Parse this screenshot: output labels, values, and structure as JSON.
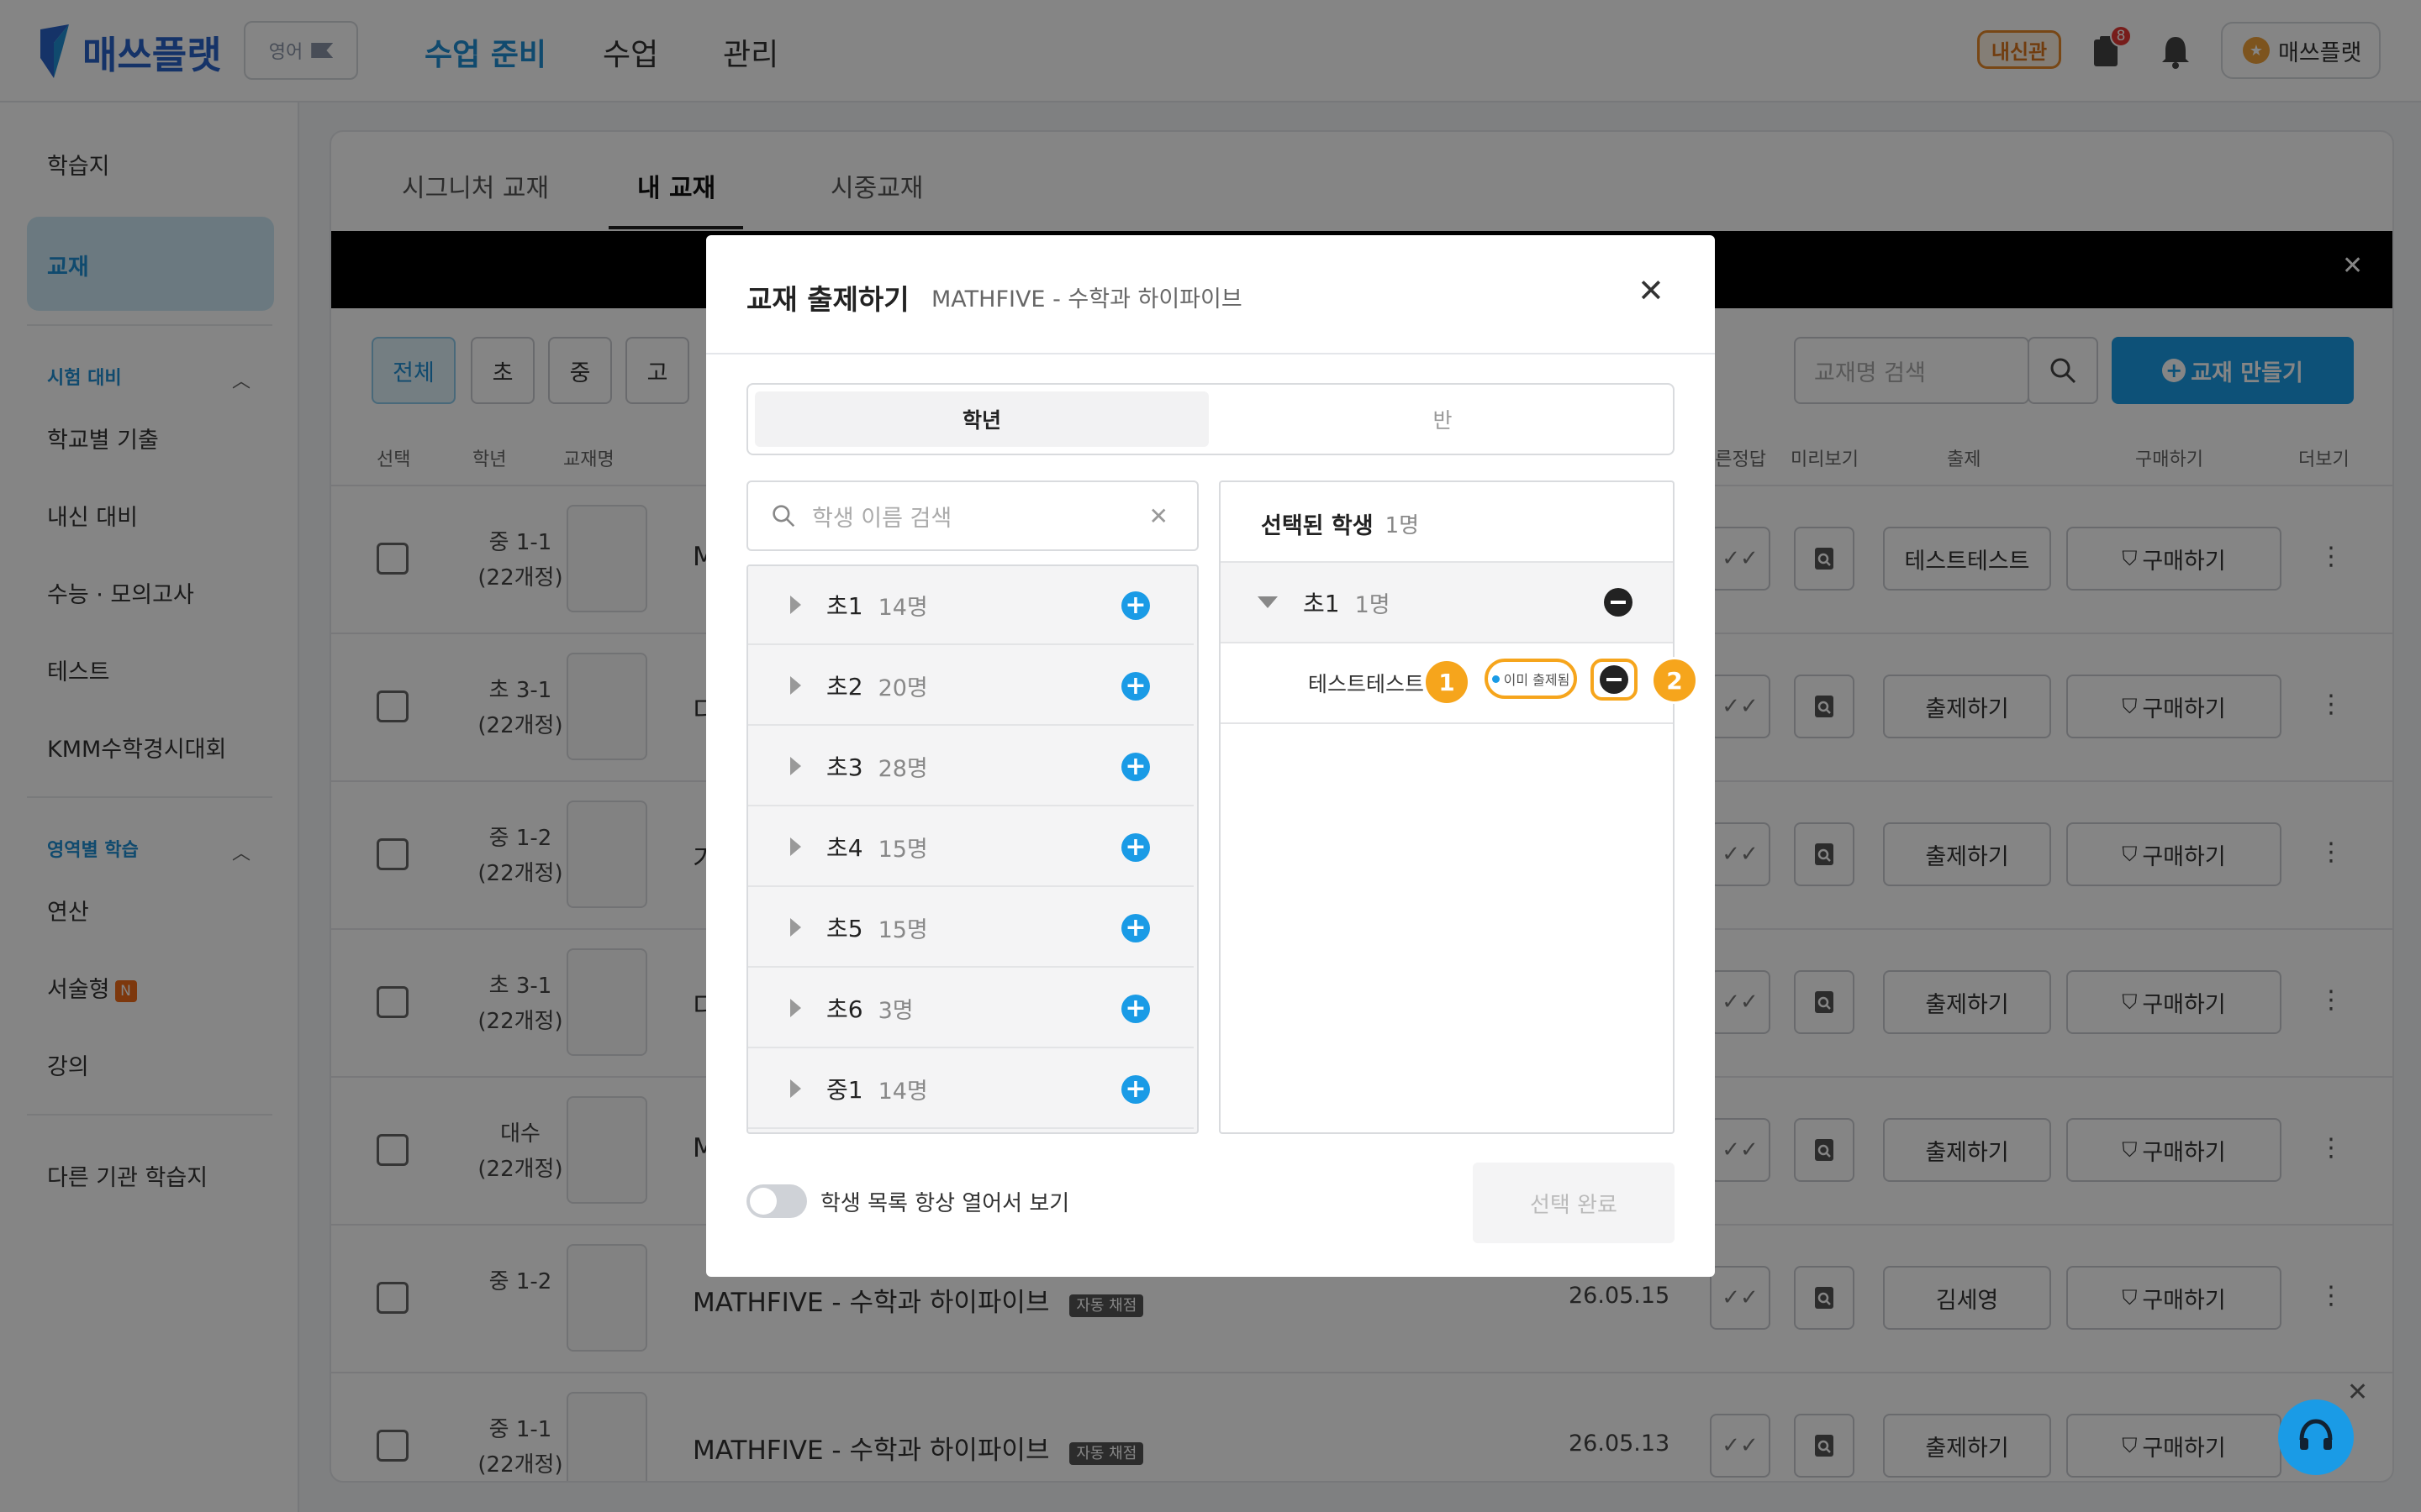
{
  "header": {
    "logo": "매쓰플랫",
    "lang_label": "영어",
    "nav": [
      "수업 준비",
      "수업",
      "관리"
    ],
    "badge_label": "내신관",
    "notif_count": "8",
    "user_name": "매쓰플랫"
  },
  "sidebar": {
    "items_top": [
      "학습지",
      "교재"
    ],
    "section1": "시험 대비",
    "section1_items": [
      "학교별 기출",
      "내신 대비",
      "수능 · 모의고사",
      "테스트",
      "KMM수학경시대회"
    ],
    "section2": "영역별 학습",
    "section2_items": [
      "연산",
      "서술형",
      "강의"
    ],
    "new_badge": "N",
    "bottom_item": "다른 기관 학습지"
  },
  "main": {
    "tabs": [
      "시그니처 교재",
      "내 교재",
      "시중교재"
    ],
    "filters": [
      "전체",
      "초",
      "중",
      "고"
    ],
    "search_placeholder": "교재명 검색",
    "create_label": "교재 만들기",
    "columns": [
      "선택",
      "학년",
      "교재명",
      "빠른정답",
      "미리보기",
      "출제",
      "구매하기",
      "더보기"
    ],
    "rows": [
      {
        "grade": "중 1-1",
        "units": "(22개정)",
        "title_initial": "M",
        "assign": "테스트테스트",
        "buy": "구매하기"
      },
      {
        "grade": "초 3-1",
        "units": "(22개정)",
        "title_initial": "디",
        "assign": "출제하기",
        "buy": "구매하기"
      },
      {
        "grade": "중 1-2",
        "units": "(22개정)",
        "title_initial": "기",
        "assign": "출제하기",
        "buy": "구매하기"
      },
      {
        "grade": "초 3-1",
        "units": "(22개정)",
        "title_initial": "디",
        "assign": "출제하기",
        "buy": "구매하기"
      },
      {
        "grade": "대수",
        "units": "(22개정)",
        "title_initial": "M",
        "assign": "출제하기",
        "buy": "구매하기"
      },
      {
        "grade": "중 1-2",
        "units": "",
        "title": "MATHFIVE - 수학과 하이파이브",
        "tag": "자동 채점",
        "date": "26.05.15",
        "assign": "김세영",
        "buy": "구매하기"
      },
      {
        "grade": "중 1-1",
        "units": "(22개정)",
        "title": "MATHFIVE - 수학과 하이파이브",
        "tag": "자동 채점",
        "date": "26.05.13",
        "assign": "출제하기",
        "buy": "구매하기"
      }
    ]
  },
  "modal": {
    "title": "교재 출제하기",
    "subtitle": "MATHFIVE - 수학과 하이파이브",
    "seg_grade": "학년",
    "seg_class": "반",
    "search_placeholder": "학생 이름 검색",
    "groups": [
      {
        "name": "초1",
        "count": "14명"
      },
      {
        "name": "초2",
        "count": "20명"
      },
      {
        "name": "초3",
        "count": "28명"
      },
      {
        "name": "초4",
        "count": "15명"
      },
      {
        "name": "초5",
        "count": "15명"
      },
      {
        "name": "초6",
        "count": "3명"
      },
      {
        "name": "중1",
        "count": "14명"
      }
    ],
    "selected_title": "선택된 학생",
    "selected_count": "1명",
    "sel_group": "초1",
    "sel_group_count": "1명",
    "student_name": "테스트테스트",
    "already_assigned": "이미 출제됨",
    "callout1": "1",
    "callout2": "2",
    "toggle_label": "학생 목록 항상 열어서 보기",
    "done_label": "선택 완료"
  }
}
